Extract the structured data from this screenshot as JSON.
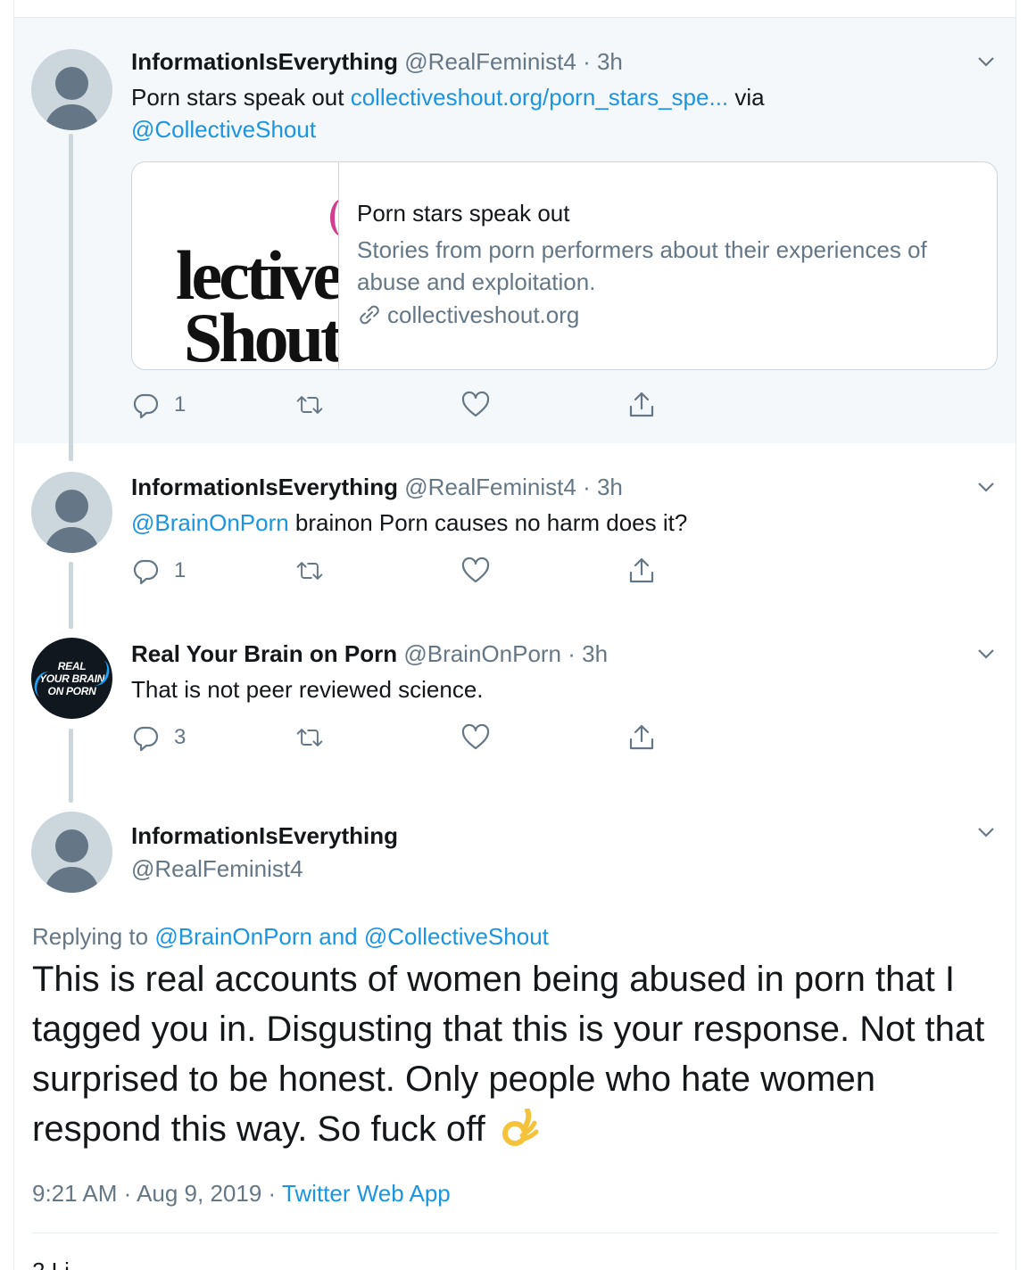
{
  "tweets": [
    {
      "display_name": "InformationIsEverything",
      "handle": "@RealFeminist4",
      "time": "· 3h",
      "text_before": "Porn stars speak out ",
      "link": "collectiveshout.org/porn_stars_spe...",
      "text_after": " via",
      "mention_line2": "@CollectiveShout",
      "card": {
        "image_text_line1": "lective",
        "image_text_line2": "Shout",
        "title": "Porn stars speak out",
        "description": "Stories from porn performers about their experiences of abuse and exploitation.",
        "domain": "collectiveshout.org"
      },
      "reply_count": "1"
    },
    {
      "display_name": "InformationIsEverything",
      "handle": "@RealFeminist4",
      "time": "· 3h",
      "mention": "@BrainOnPorn",
      "text": " brainon Porn causes no harm does it?",
      "reply_count": "1"
    },
    {
      "display_name": "Real Your Brain on Porn",
      "handle": "@BrainOnPorn",
      "time": "· 3h",
      "avatar_text": [
        "REAL",
        "YOUR BRAIN",
        "ON PORN"
      ],
      "text": "That is not peer reviewed science.",
      "reply_count": "3"
    }
  ],
  "main_tweet": {
    "display_name": "InformationIsEverything",
    "handle": "@RealFeminist4",
    "replying_label": "Replying to ",
    "replying_mentions": "@BrainOnPorn and @CollectiveShout",
    "text": "This is real accounts of women being abused in porn that I tagged you in. Disgusting that this is your response. Not that surprised to be honest. Only people who hate women respond this way. So fuck off",
    "emoji": "ok-hand-emoji",
    "time": "9:21 AM · Aug 9, 2019 · ",
    "source": "Twitter Web App",
    "stats_peek": "2 Li"
  },
  "colors": {
    "link": "#1b95e0",
    "muted": "#657786",
    "text": "#14171a",
    "border": "#e6ecf0",
    "focus_bg": "#f5f8fa"
  }
}
